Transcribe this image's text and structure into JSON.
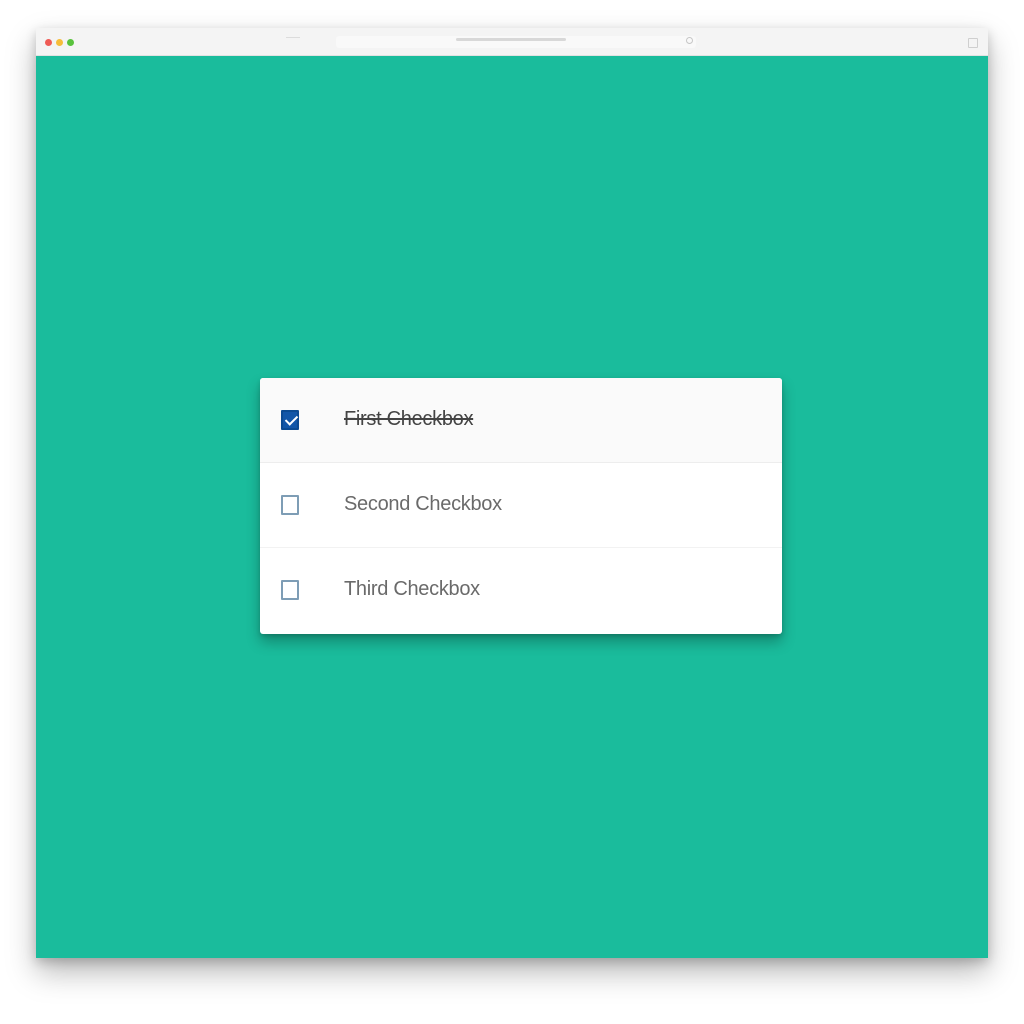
{
  "colors": {
    "page_background": "#ffffff",
    "app_background": "#1abc9c",
    "card_background": "#ffffff",
    "checkbox_checked": "#1256a8"
  },
  "window": {
    "controls": [
      "close",
      "minimize",
      "maximize"
    ]
  },
  "checklist": {
    "items": [
      {
        "label": "First Checkbox",
        "checked": true,
        "strikethrough": true
      },
      {
        "label": "Second Checkbox",
        "checked": false,
        "strikethrough": false
      },
      {
        "label": "Third Checkbox",
        "checked": false,
        "strikethrough": false
      }
    ]
  }
}
